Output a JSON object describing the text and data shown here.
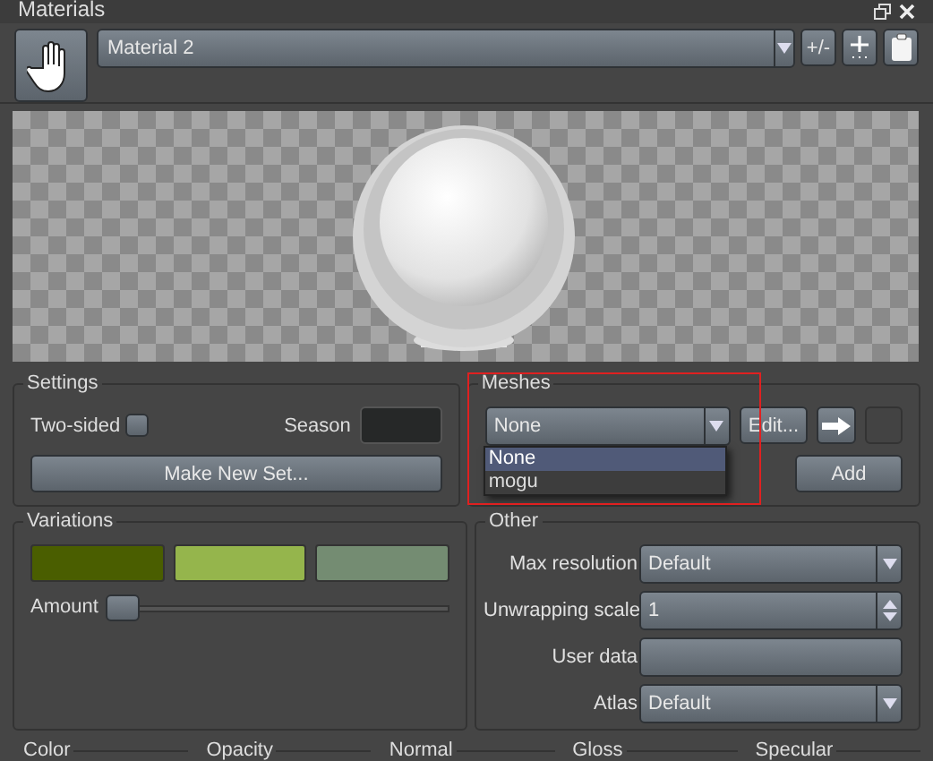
{
  "panel": {
    "title": "Materials"
  },
  "material_select": {
    "value": "Material 2"
  },
  "toolbar_buttons": [
    {
      "kind": "text",
      "label": "+/-"
    },
    {
      "kind": "add"
    },
    {
      "kind": "paste"
    }
  ],
  "settings": {
    "title": "Settings",
    "two_sided": {
      "label": "Two-sided",
      "checked": false
    },
    "season": {
      "label": "Season",
      "color": "#262828"
    },
    "make_button": "Make New Set..."
  },
  "meshes": {
    "title": "Meshes",
    "select": {
      "value": "None",
      "expanded": true
    },
    "options": [
      {
        "label": "None",
        "selected": true
      },
      {
        "label": "mogu",
        "selected": false
      }
    ],
    "edit_button": "Edit...",
    "add_button": "Add"
  },
  "variations": {
    "title": "Variations",
    "swatches": [
      {
        "color": "#4a5e00"
      },
      {
        "color": "#95b54c"
      },
      {
        "color": "#748c72"
      }
    ],
    "amount": {
      "label": "Amount",
      "level": 0
    }
  },
  "other": {
    "title": "Other",
    "fields": [
      {
        "kind": "select",
        "label": "Max resolution",
        "value": "Default"
      },
      {
        "kind": "spin",
        "label": "Unwrapping scale",
        "value": "1"
      },
      {
        "kind": "text",
        "label": "User data"
      },
      {
        "kind": "select",
        "label": "Atlas",
        "value": "Default"
      }
    ]
  },
  "channels": [
    "Color",
    "Opacity",
    "Normal",
    "Gloss",
    "Specular"
  ]
}
